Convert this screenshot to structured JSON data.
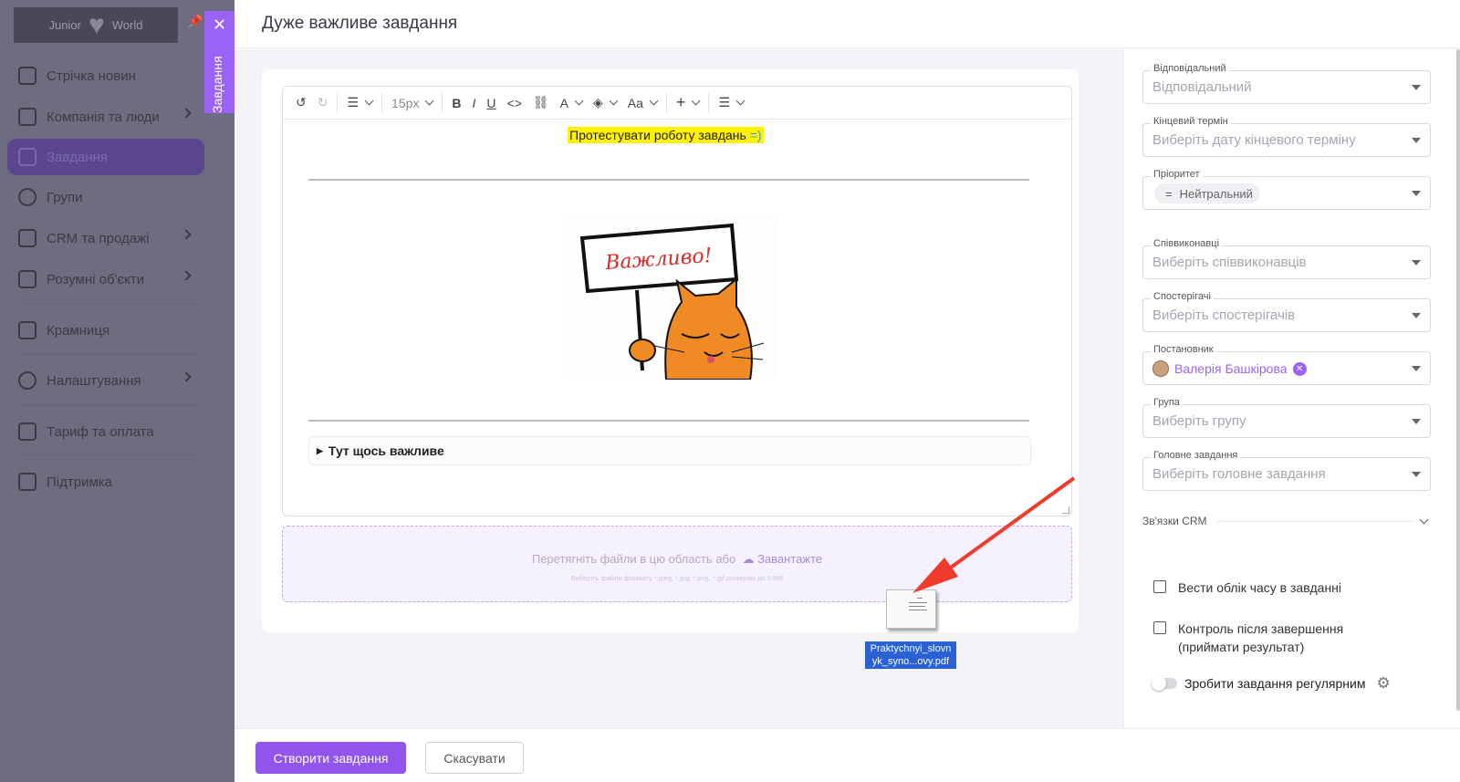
{
  "app": {
    "logo_left": "Junior",
    "logo_right": "World",
    "nav": [
      {
        "label": "Стрічка новин"
      },
      {
        "label": "Компанія та люди"
      },
      {
        "label": "Завдання"
      },
      {
        "label": "Групи"
      },
      {
        "label": "CRM та продажі"
      },
      {
        "label": "Розумні об'єкти"
      },
      {
        "label": "Крамниця"
      },
      {
        "label": "Налаштування"
      },
      {
        "label": "Тариф та оплата"
      },
      {
        "label": "Підтримка"
      }
    ],
    "side_tab_label": "Завдання",
    "side_tab_close": "✕"
  },
  "modal": {
    "title": "Дуже важливе завдання",
    "toolbar": {
      "font_size": "15px",
      "case_label": "Aa",
      "font_color_label": "A"
    },
    "content": {
      "highlight_text": "Протестувати роботу завдань ",
      "smiley": "=)",
      "picture_text": "Важливо!",
      "details_summary": "Тут щось важливе"
    },
    "dropzone": {
      "text": "Перетягніть файли в цю область або",
      "upload_label": "Завантажте",
      "hint": "Виберіть файли формату *.jpeg, *.jpg, *.png, *.gif розміром до 5 MB"
    },
    "dragged_file": {
      "name_line1": "Praktychnyi_slovn",
      "name_line2": "yk_syno...ovy.pdf"
    },
    "fields": [
      {
        "label": "Відповідальний",
        "placeholder": "Відповідальний"
      },
      {
        "label": "Кінцевий термін",
        "placeholder": "Виберіть дату кінцевого терміну"
      },
      {
        "label": "Пріоритет",
        "value": "Нейтральний"
      },
      {
        "label": "Співвиконавці",
        "placeholder": "Виберіть співвиконавців"
      },
      {
        "label": "Спостерігачі",
        "placeholder": "Виберіть спостерігачів"
      },
      {
        "label": "Постановник",
        "value": "Валерія Башкірова"
      },
      {
        "label": "Група",
        "placeholder": "Виберіть групу"
      },
      {
        "label": "Головне завдання",
        "placeholder": "Виберіть головне завдання"
      }
    ],
    "crm_label": "Зв'язки CRM",
    "checks": [
      {
        "label": "Вести облік часу в завданні",
        "checked": false
      },
      {
        "label_line1": "Контроль після завершення",
        "label_line2": "(приймати результат)",
        "checked": false
      }
    ],
    "recurring_label": "Зробити завдання регулярним",
    "buttons": {
      "create": "Створити завдання",
      "cancel": "Скасувати"
    }
  },
  "colors": {
    "accent": "#9155ee",
    "highlight": "#fff200",
    "overlay": "#6f6d80"
  }
}
